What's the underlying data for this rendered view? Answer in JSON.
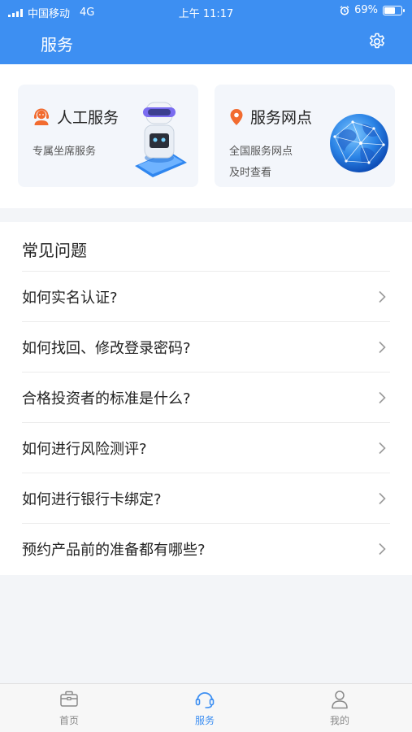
{
  "status_bar": {
    "carrier": "中国移动",
    "network": "4G",
    "time": "上午 11:17",
    "battery": "69%",
    "battery_level": 0.69
  },
  "header": {
    "title": "服务"
  },
  "service_cards": [
    {
      "title": "人工服务",
      "subtitle_line1": "专属坐席服务",
      "subtitle_line2": ""
    },
    {
      "title": "服务网点",
      "subtitle_line1": "全国服务网点",
      "subtitle_line2": "及时查看"
    }
  ],
  "faq": {
    "title": "常见问题",
    "items": [
      "如何实名认证?",
      "如何找回、修改登录密码?",
      "合格投资者的标准是什么?",
      "如何进行风险测评?",
      "如何进行银行卡绑定?",
      "预约产品前的准备都有哪些?"
    ]
  },
  "bottom_nav": {
    "items": [
      {
        "label": "首页",
        "icon": "briefcase-icon",
        "active": false
      },
      {
        "label": "服务",
        "icon": "headset-icon",
        "active": true
      },
      {
        "label": "我的",
        "icon": "user-icon",
        "active": false
      }
    ]
  },
  "colors": {
    "primary": "#3d8ff2",
    "service_icon": "#f26b2f",
    "location_icon": "#f26b2f",
    "nav_inactive": "#8a8a8a"
  }
}
